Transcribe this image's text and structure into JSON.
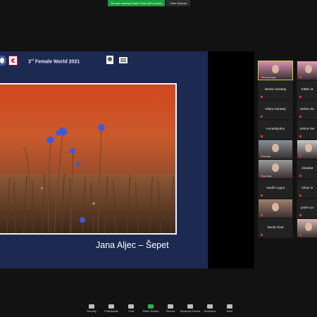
{
  "banner": {
    "sharing_text": "You are viewing Šedler Petra (#R) screen",
    "options_label": "View Options"
  },
  "slide": {
    "title_main": "3",
    "title_sup": "rd",
    "title_rest": " Female World 2021",
    "caption": "Jana Aljec – Šepet"
  },
  "participants": [
    {
      "name": "Lidia Casanegra",
      "video": true
    },
    {
      "name": "",
      "video": true
    },
    {
      "name": "Nesrin Karataş",
      "video": false
    },
    {
      "name": "SİBEL B",
      "video": false
    },
    {
      "name": "Dilara Karataş",
      "video": false
    },
    {
      "name": "Selma Se",
      "video": false
    },
    {
      "name": "muratalyukut",
      "video": false
    },
    {
      "name": "Selma Ser",
      "video": false
    },
    {
      "name": "Pınar Akar",
      "video": true
    },
    {
      "name": "",
      "video": true
    },
    {
      "name": "Gökçe Ziya",
      "video": true
    },
    {
      "name": "Abdullat",
      "video": false
    },
    {
      "name": "Hanife Uygur",
      "video": false
    },
    {
      "name": "Cihan S",
      "video": false
    },
    {
      "name": "",
      "video": true
    },
    {
      "name": "yasim yu",
      "video": false
    },
    {
      "name": "Burak Ünal",
      "video": false
    },
    {
      "name": "",
      "video": true
    }
  ],
  "toolbar": [
    {
      "label": "Security",
      "icon": "shield-icon",
      "green": false
    },
    {
      "label": "Participants",
      "icon": "people-icon",
      "green": false
    },
    {
      "label": "Chat",
      "icon": "chat-icon",
      "green": false
    },
    {
      "label": "Share Screen",
      "icon": "share-screen-icon",
      "green": true
    },
    {
      "label": "Record",
      "icon": "record-icon",
      "green": false
    },
    {
      "label": "Breakout Rooms",
      "icon": "grid-icon",
      "green": false
    },
    {
      "label": "Reactions",
      "icon": "smile-icon",
      "green": false
    },
    {
      "label": "More",
      "icon": "more-icon",
      "green": false
    }
  ],
  "colors": {
    "share_green": "#1a9f3d",
    "slide_bg": "#1c2a52",
    "active_speaker": "#c8d44a"
  }
}
